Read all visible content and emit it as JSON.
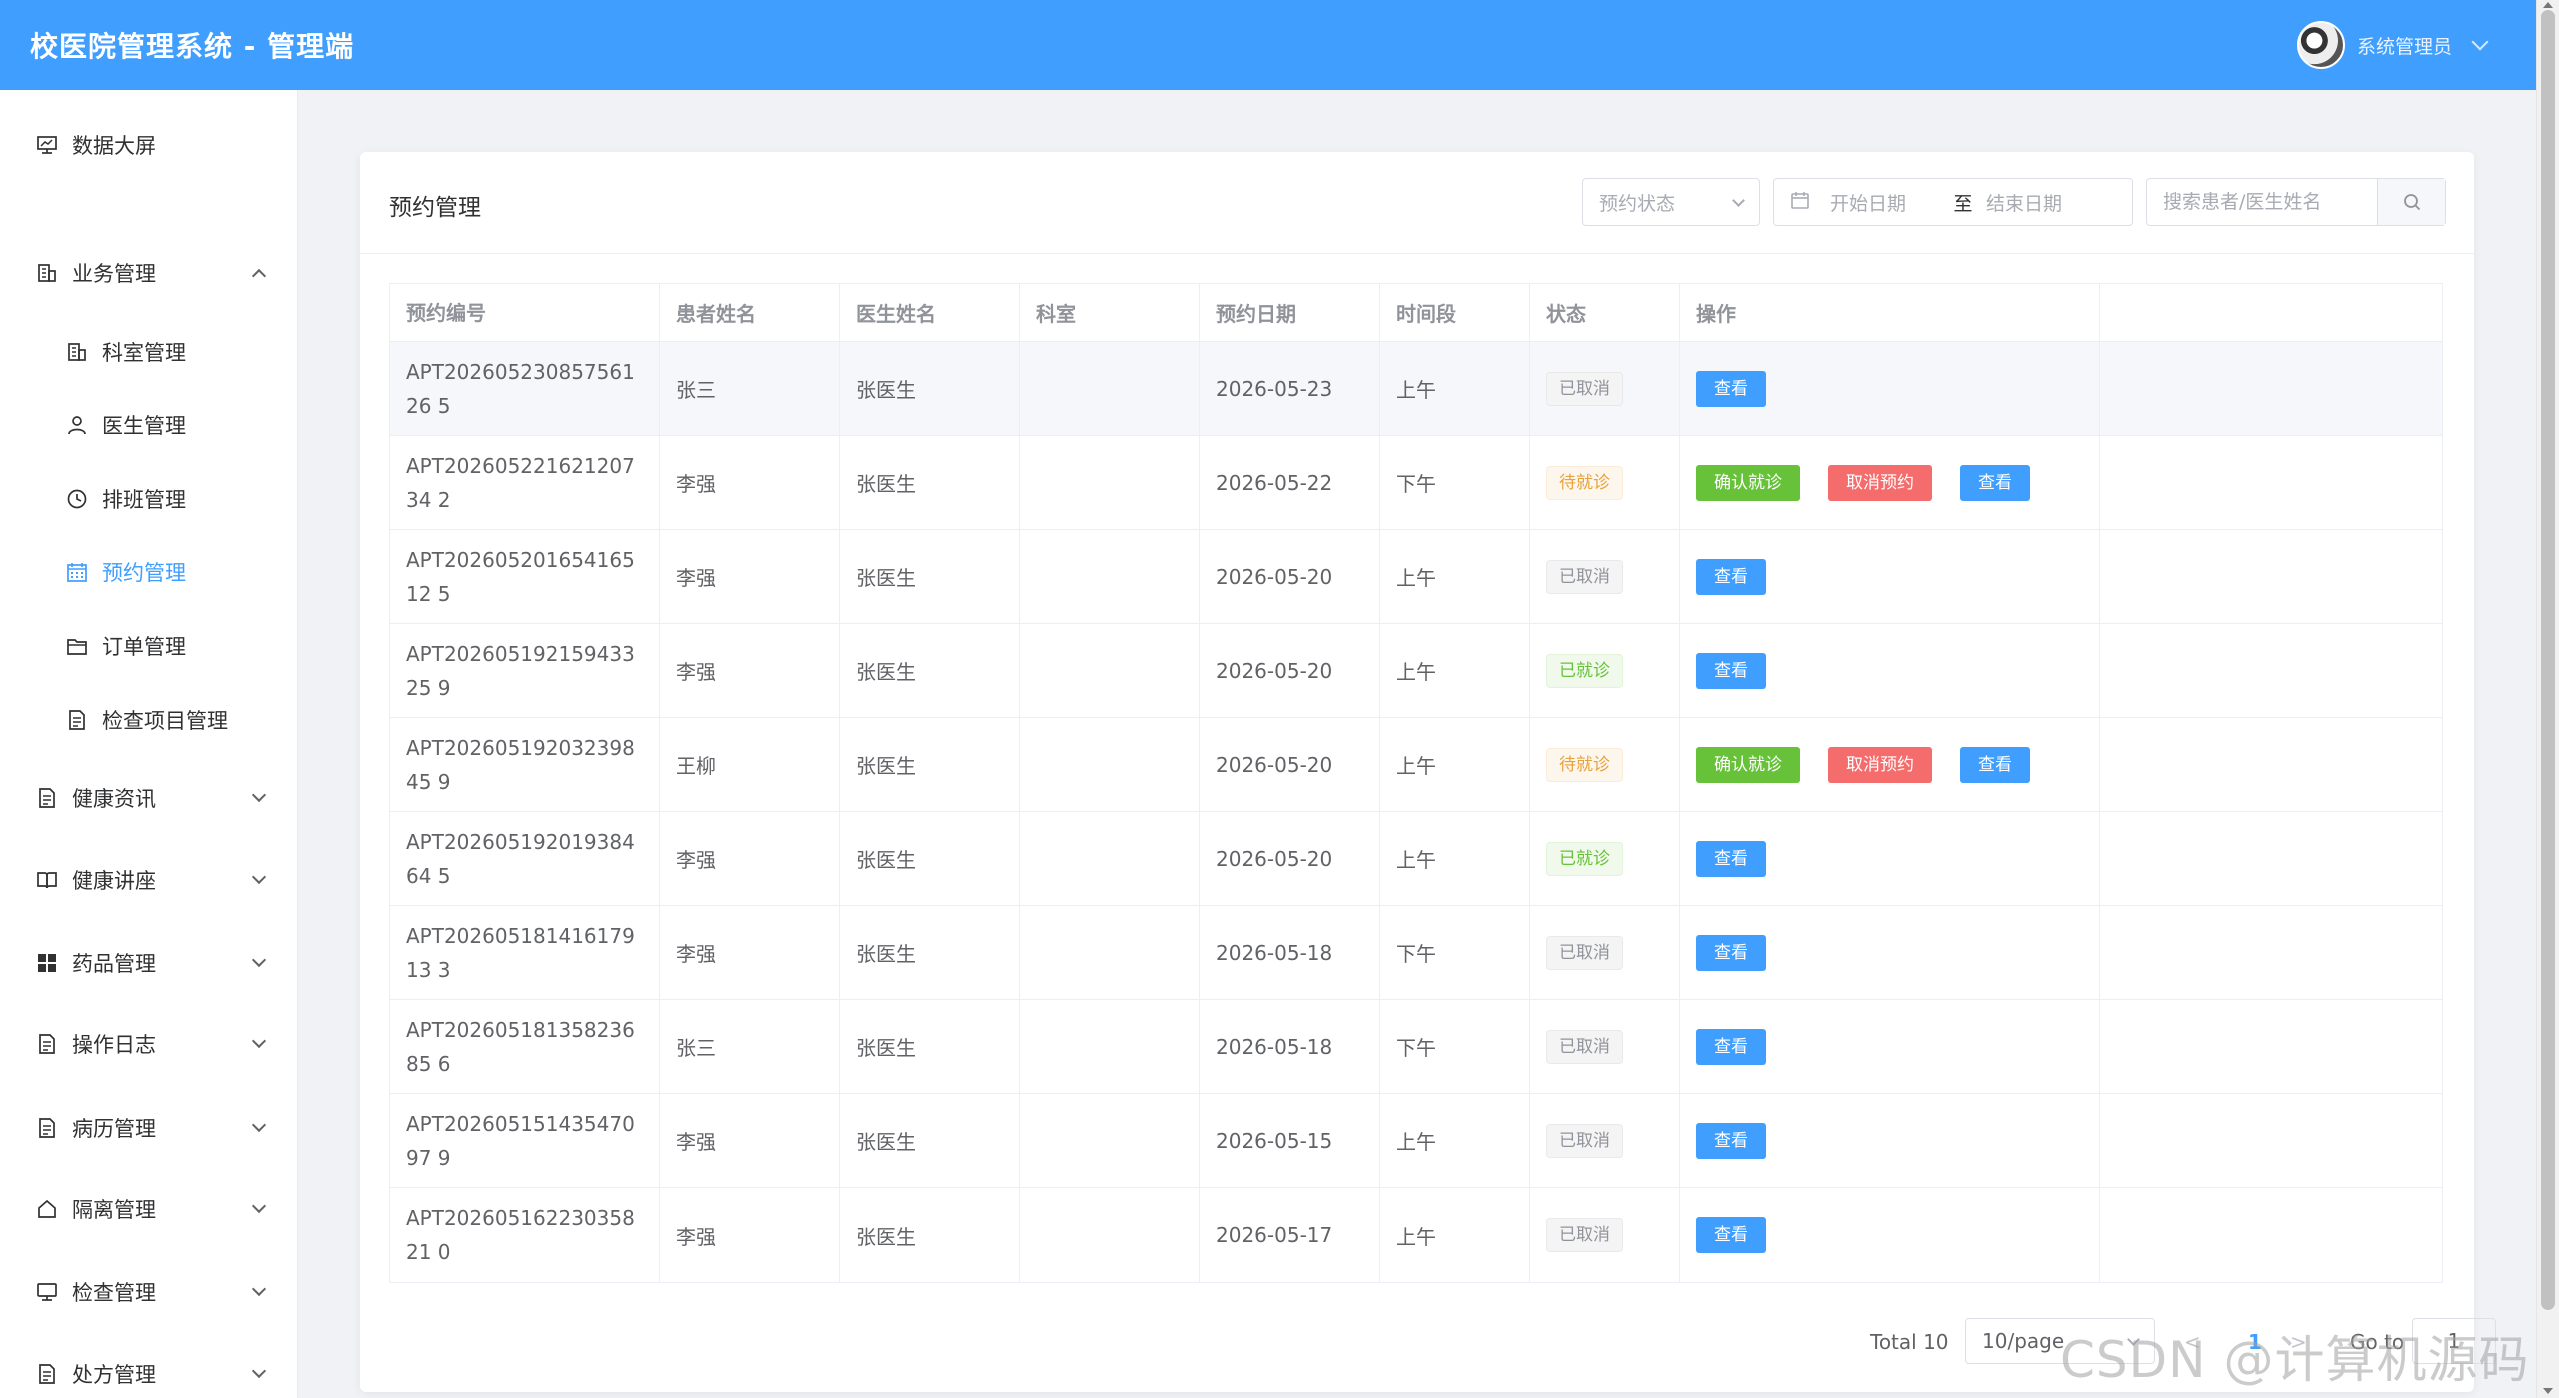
{
  "header": {
    "title": "校医院管理系统 - 管理端",
    "user_name": "系统管理员"
  },
  "sidebar": {
    "items": [
      {
        "label": "数据大屏",
        "icon": "dashboard-icon"
      },
      {
        "label": "业务管理",
        "icon": "building-icon",
        "expanded": true
      },
      {
        "label": "科室管理",
        "icon": "building-icon",
        "sub": true
      },
      {
        "label": "医生管理",
        "icon": "user-icon",
        "sub": true
      },
      {
        "label": "排班管理",
        "icon": "clock-icon",
        "sub": true
      },
      {
        "label": "预约管理",
        "icon": "calendar-icon",
        "sub": true,
        "active": true
      },
      {
        "label": "订单管理",
        "icon": "folder-icon",
        "sub": true
      },
      {
        "label": "检查项目管理",
        "icon": "document-icon",
        "sub": true
      },
      {
        "label": "健康资讯",
        "icon": "document-icon"
      },
      {
        "label": "健康讲座",
        "icon": "book-icon"
      },
      {
        "label": "药品管理",
        "icon": "grid-icon"
      },
      {
        "label": "操作日志",
        "icon": "document-icon"
      },
      {
        "label": "病历管理",
        "icon": "document-icon"
      },
      {
        "label": "隔离管理",
        "icon": "house-icon"
      },
      {
        "label": "检查管理",
        "icon": "monitor-icon"
      },
      {
        "label": "处方管理",
        "icon": "document-icon"
      }
    ]
  },
  "card": {
    "title": "预约管理"
  },
  "filters": {
    "status_placeholder": "预约状态",
    "start_date_placeholder": "开始日期",
    "date_separator": "至",
    "end_date_placeholder": "结束日期",
    "search_placeholder": "搜索患者/医生姓名"
  },
  "table": {
    "columns": [
      "预约编号",
      "患者姓名",
      "医生姓名",
      "科室",
      "预约日期",
      "时间段",
      "状态",
      "操作"
    ],
    "rows": [
      {
        "id": "APT20260523085756126 5",
        "patient": "张三",
        "doctor": "张医生",
        "dept": "",
        "date": "2026-05-23",
        "slot": "上午",
        "status": "已取消",
        "status_type": "cancel",
        "actions": [
          "查看"
        ]
      },
      {
        "id": "APT20260522162120734 2",
        "patient": "李强",
        "doctor": "张医生",
        "dept": "",
        "date": "2026-05-22",
        "slot": "下午",
        "status": "待就诊",
        "status_type": "pending",
        "actions": [
          "确认就诊",
          "取消预约",
          "查看"
        ]
      },
      {
        "id": "APT20260520165416512 5",
        "patient": "李强",
        "doctor": "张医生",
        "dept": "",
        "date": "2026-05-20",
        "slot": "上午",
        "status": "已取消",
        "status_type": "cancel",
        "actions": [
          "查看"
        ]
      },
      {
        "id": "APT20260519215943325 9",
        "patient": "李强",
        "doctor": "张医生",
        "dept": "",
        "date": "2026-05-20",
        "slot": "上午",
        "status": "已就诊",
        "status_type": "done",
        "actions": [
          "查看"
        ]
      },
      {
        "id": "APT20260519203239845 9",
        "patient": "王柳",
        "doctor": "张医生",
        "dept": "",
        "date": "2026-05-20",
        "slot": "上午",
        "status": "待就诊",
        "status_type": "pending",
        "actions": [
          "确认就诊",
          "取消预约",
          "查看"
        ]
      },
      {
        "id": "APT20260519201938464 5",
        "patient": "李强",
        "doctor": "张医生",
        "dept": "",
        "date": "2026-05-20",
        "slot": "上午",
        "status": "已就诊",
        "status_type": "done",
        "actions": [
          "查看"
        ]
      },
      {
        "id": "APT20260518141617913 3",
        "patient": "李强",
        "doctor": "张医生",
        "dept": "",
        "date": "2026-05-18",
        "slot": "下午",
        "status": "已取消",
        "status_type": "cancel",
        "actions": [
          "查看"
        ]
      },
      {
        "id": "APT20260518135823685 6",
        "patient": "张三",
        "doctor": "张医生",
        "dept": "",
        "date": "2026-05-18",
        "slot": "下午",
        "status": "已取消",
        "status_type": "cancel",
        "actions": [
          "查看"
        ]
      },
      {
        "id": "APT20260515143547097 9",
        "patient": "李强",
        "doctor": "张医生",
        "dept": "",
        "date": "2026-05-15",
        "slot": "上午",
        "status": "已取消",
        "status_type": "cancel",
        "actions": [
          "查看"
        ]
      },
      {
        "id": "APT20260516223035821 0",
        "patient": "李强",
        "doctor": "张医生",
        "dept": "",
        "date": "2026-05-17",
        "slot": "上午",
        "status": "已取消",
        "status_type": "cancel",
        "actions": [
          "查看"
        ]
      }
    ]
  },
  "pagination": {
    "total": "Total 10",
    "page_size": "10/page",
    "prev": "<",
    "current_page": "1",
    "next": ">",
    "goto_label": "Go to",
    "goto_value": "1"
  },
  "watermark": "CSDN @计算机源码站",
  "colors": {
    "primary": "#409eff",
    "success": "#67c23a",
    "danger": "#f56c6c",
    "warning": "#e6a23c",
    "info": "#909399"
  }
}
